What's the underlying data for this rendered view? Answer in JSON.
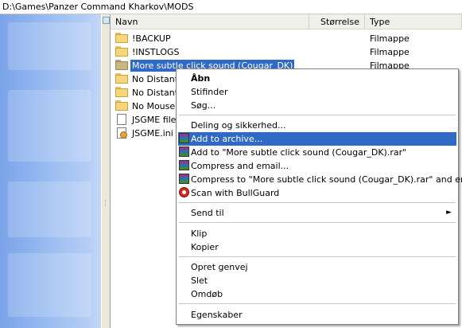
{
  "address_bar": {
    "path": "D:\\Games\\Panzer Command Kharkov\\MODS"
  },
  "columns": {
    "name": "Navn",
    "size": "Størrelse",
    "type": "Type"
  },
  "files": [
    {
      "name": "!BACKUP",
      "type": "Filmappe",
      "icon": "folder-icon"
    },
    {
      "name": "!INSTLOGS",
      "type": "Filmappe",
      "icon": "folder-icon"
    },
    {
      "name": "More subtle click sound (Cougar_DK)",
      "type": "Filmappe",
      "icon": "folder-icon",
      "selected": true
    },
    {
      "name": "No Distant C",
      "type": "",
      "icon": "folder-icon"
    },
    {
      "name": "No Distant F",
      "type": "",
      "icon": "folder-icon"
    },
    {
      "name": "No Mouse C",
      "type": "",
      "icon": "folder-icon"
    },
    {
      "name": "JSGME file s",
      "type": "",
      "icon": "text-file-icon"
    },
    {
      "name": "JSGME.ini",
      "type": "",
      "icon": "ini-file-icon"
    }
  ],
  "context_menu": {
    "items": [
      {
        "label": "Åbn"
      },
      {
        "label": "Stifinder"
      },
      {
        "label": "Søg..."
      },
      {
        "label": "Deling og sikkerhed..."
      },
      {
        "label": "Add to archive...",
        "icon": "winrar-icon"
      },
      {
        "label": "Add to \"More subtle click sound (Cougar_DK).rar\"",
        "icon": "winrar-icon"
      },
      {
        "label": "Compress and email...",
        "icon": "winrar-icon"
      },
      {
        "label": "Compress to \"More subtle click sound (Cougar_DK).rar\" and email",
        "icon": "winrar-icon"
      },
      {
        "label": "Scan with BullGuard",
        "icon": "bullguard-icon"
      },
      {
        "label": "Send til",
        "submenu_arrow": "►"
      },
      {
        "label": "Klip"
      },
      {
        "label": "Kopier"
      },
      {
        "label": "Opret genvej"
      },
      {
        "label": "Slet"
      },
      {
        "label": "Omdøb"
      },
      {
        "label": "Egenskaber"
      }
    ]
  },
  "colors": {
    "selection": "#316ac5",
    "sidebar": "#8db3ef",
    "menu_border": "#808080"
  }
}
